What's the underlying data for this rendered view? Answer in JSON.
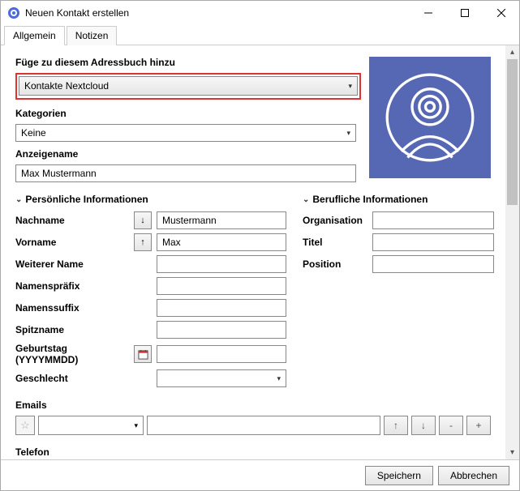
{
  "window": {
    "title": "Neuen Kontakt erstellen"
  },
  "tabs": {
    "general": "Allgemein",
    "notes": "Notizen"
  },
  "addressbook": {
    "label": "Füge zu diesem Adressbuch hinzu",
    "value": "Kontakte Nextcloud"
  },
  "categories": {
    "label": "Kategorien",
    "value": "Keine"
  },
  "displayname": {
    "label": "Anzeigename",
    "value": "Max Mustermann"
  },
  "personal": {
    "header": "Persönliche Informationen",
    "lastname_label": "Nachname",
    "lastname": "Mustermann",
    "firstname_label": "Vorname",
    "firstname": "Max",
    "othername_label": "Weiterer Name",
    "othername": "",
    "prefix_label": "Namenspräfix",
    "prefix": "",
    "suffix_label": "Namenssuffix",
    "suffix": "",
    "nickname_label": "Spitzname",
    "nickname": "",
    "birthday_label": "Geburtstag (YYYYMMDD)",
    "birthday": "",
    "gender_label": "Geschlecht",
    "gender": ""
  },
  "business": {
    "header": "Berufliche Informationen",
    "org_label": "Organisation",
    "org": "",
    "title_label": "Titel",
    "title": "",
    "position_label": "Position",
    "position": ""
  },
  "emails": {
    "header": "Emails",
    "type": "",
    "value": ""
  },
  "phone": {
    "header": "Telefon"
  },
  "arrows": {
    "down": "↓",
    "up": "↑"
  },
  "buttons": {
    "save": "Speichern",
    "cancel": "Abbrechen",
    "plus": "+",
    "minus": "-"
  }
}
